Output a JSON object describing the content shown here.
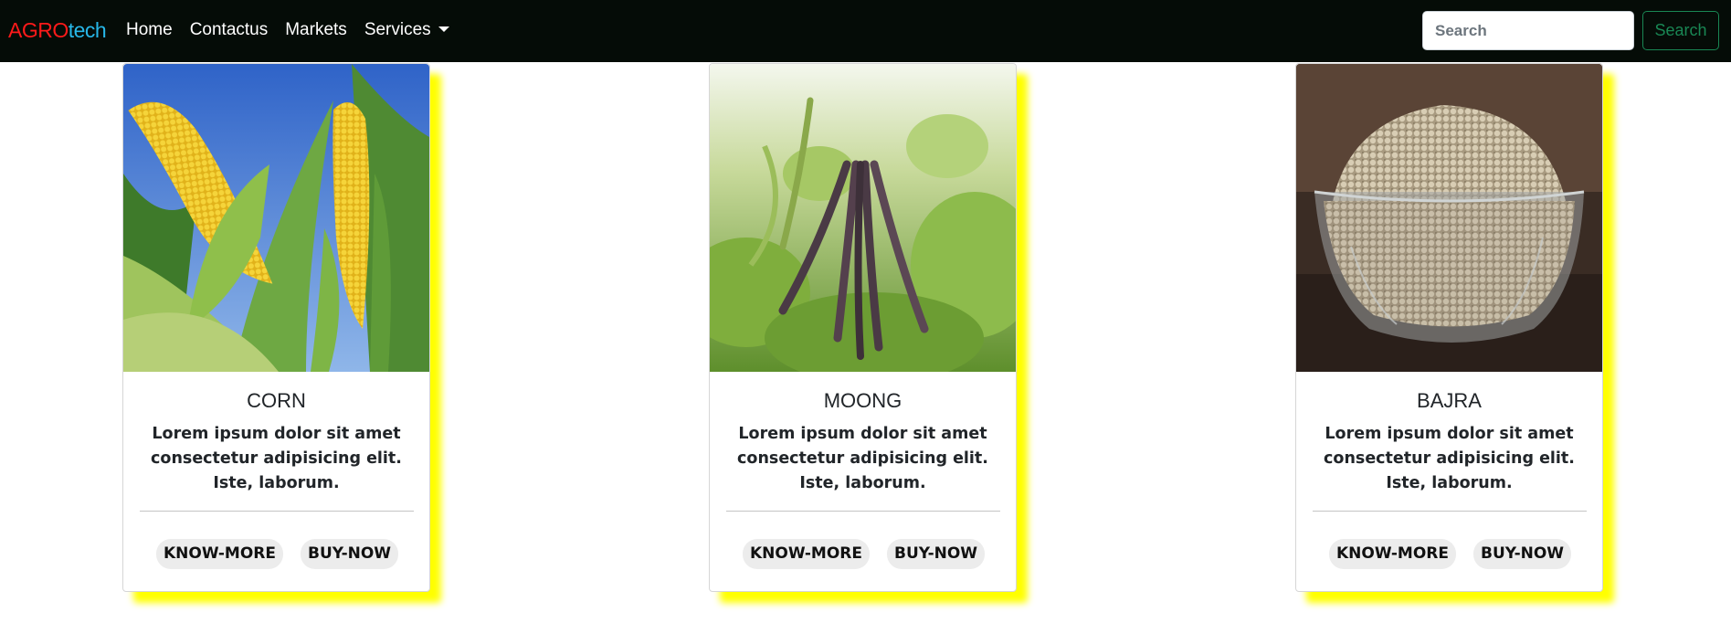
{
  "brand": {
    "part1": "AGRO",
    "part2": "tech"
  },
  "nav": {
    "links": [
      "Home",
      "Contactus",
      "Markets",
      "Services"
    ]
  },
  "search": {
    "placeholder": "Search",
    "button_label": "Search"
  },
  "cards": [
    {
      "title": "CORN",
      "text": "Lorem ipsum dolor sit amet consectetur adipisicing elit. Iste, laborum.",
      "know_label": "KNOW-MORE",
      "buy_label": "BUY-NOW",
      "image": "corn-image"
    },
    {
      "title": "MOONG",
      "text": "Lorem ipsum dolor sit amet consectetur adipisicing elit. Iste, laborum.",
      "know_label": "KNOW-MORE",
      "buy_label": "BUY-NOW",
      "image": "moong-image"
    },
    {
      "title": "BAJRA",
      "text": "Lorem ipsum dolor sit amet consectetur adipisicing elit. Iste, laborum.",
      "know_label": "KNOW-MORE",
      "buy_label": "BUY-NOW",
      "image": "bajra-image"
    }
  ],
  "colors": {
    "navbar": "#050c07",
    "brand_red": "#ff1a1a",
    "brand_blue": "#27b7e8",
    "card_shadow": "#ffff00",
    "search_green": "#198754"
  }
}
